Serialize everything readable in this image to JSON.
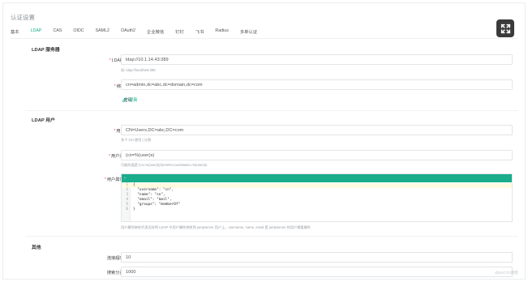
{
  "page": {
    "title": "认证设置"
  },
  "tabs": [
    {
      "label": "基本"
    },
    {
      "label": "LDAP"
    },
    {
      "label": "CAS"
    },
    {
      "label": "OIDC"
    },
    {
      "label": "SAML2"
    },
    {
      "label": "OAuth2"
    },
    {
      "label": "企业微信"
    },
    {
      "label": "钉钉"
    },
    {
      "label": "飞书"
    },
    {
      "label": "Radius"
    },
    {
      "label": "多单认证"
    }
  ],
  "ldap_server": {
    "section_title": "LDAP 服务器",
    "address_label": "LDAP 地址",
    "address_value": "ldap://10.1.14.43:389",
    "address_help": "如: ldap://localhost:389",
    "bind_dn_label": "绑定 DN",
    "bind_dn_value": "cn=admin,dc=abc,dc=domain,dc=com",
    "password_label": "密码",
    "password_link": "更新"
  },
  "ldap_user": {
    "section_title": "LDAP 用户",
    "ou_label": "用户 OU",
    "ou_value": "CN=Users,DC=abc,DC=com",
    "ou_help": "多个 OU 使用 | 分割",
    "filter_label": "用户过滤器",
    "filter_value": "(cn=%(user)s)",
    "filter_help": "可能的值是 (cn=%(user)s)/(sAMAccountName=%(user)s)",
    "mapping_label": "用户属性映射",
    "editor_bar": "›",
    "code_lines": [
      {
        "n": "1",
        "text": "{"
      },
      {
        "n": "2",
        "text": "  \"username\": \"cn\","
      },
      {
        "n": "3",
        "text": "  \"name\": \"sn\","
      },
      {
        "n": "4",
        "text": "  \"email\": \"mail\","
      },
      {
        "n": "5",
        "text": "  \"groups\": \"memberOf\""
      },
      {
        "n": "6",
        "text": "}"
      }
    ],
    "mapping_help": "用户属性映射代表怎样将 LDAP 中用户属性映射到 jumpserver 用户上，username, name, email 是 jumpserver 的用户需要属性"
  },
  "other": {
    "section_title": "其他",
    "sync_interval_label": "连接超时时间",
    "sync_interval_value": "10",
    "search_size_label": "搜索分页数量",
    "search_size_value": "1000"
  },
  "watermark": "@51CTO博客",
  "icons": {
    "fullscreen": "expand-arrows-icon"
  },
  "colors": {
    "accent": "#1aad8b",
    "required": "#e24d4d"
  }
}
